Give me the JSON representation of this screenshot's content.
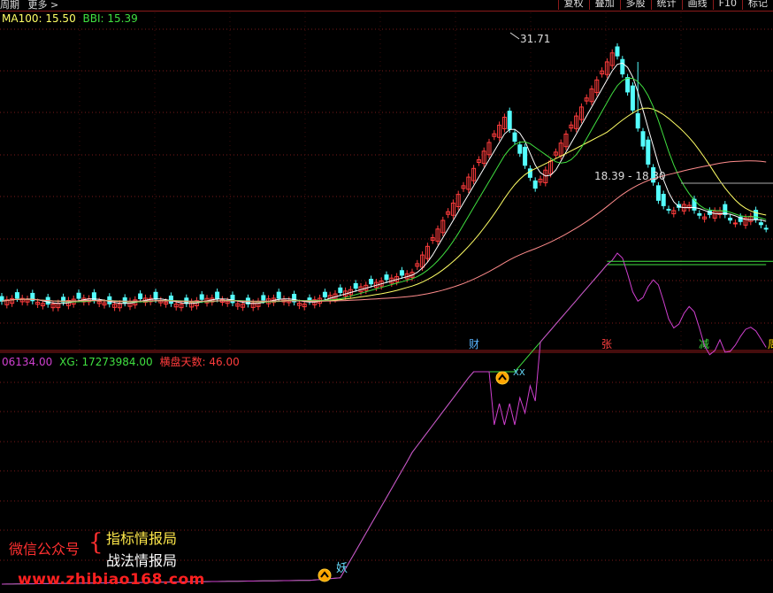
{
  "toolbar": {
    "left": [
      "周期",
      "更多 >"
    ],
    "buttons": [
      "复权",
      "叠加",
      "多股",
      "统计",
      "画线",
      "F10",
      "标记"
    ]
  },
  "main_legend": {
    "ma100_label": "MA100:",
    "ma100_value": "15.50",
    "bbi_label": "BBI:",
    "bbi_value": "15.39"
  },
  "sub_legend": {
    "val1": "06134.00",
    "xg_label": "XG:",
    "xg_value": "17273984.00",
    "days_label": "横盘天数:",
    "days_value": "46.00"
  },
  "annotations": {
    "peak_label": "31.71",
    "range_label": "18.39 - 18.30",
    "event_markers": [
      {
        "text": "财",
        "color": "#5ab4ff"
      },
      {
        "text": "张",
        "color": "#ff4040"
      },
      {
        "text": "减",
        "color": "#40e040"
      },
      {
        "text": "周",
        "color": "#ffd700"
      }
    ],
    "yao_label": "妖",
    "xx_label": "XX"
  },
  "watermark": {
    "wechat": "微信公众号",
    "line1": "指标情报局",
    "line2": "战法情报局",
    "url": "www.zhibiao168.com"
  },
  "colors": {
    "up": "#ff3c3c",
    "down": "#54ffff",
    "ma_white": "#ffffff",
    "ma_yellow": "#ffff66",
    "ma_green": "#40e040",
    "ma_pink": "#ff8c8c",
    "sub_green": "#40e040",
    "sub_magenta": "#d040d0"
  }
}
